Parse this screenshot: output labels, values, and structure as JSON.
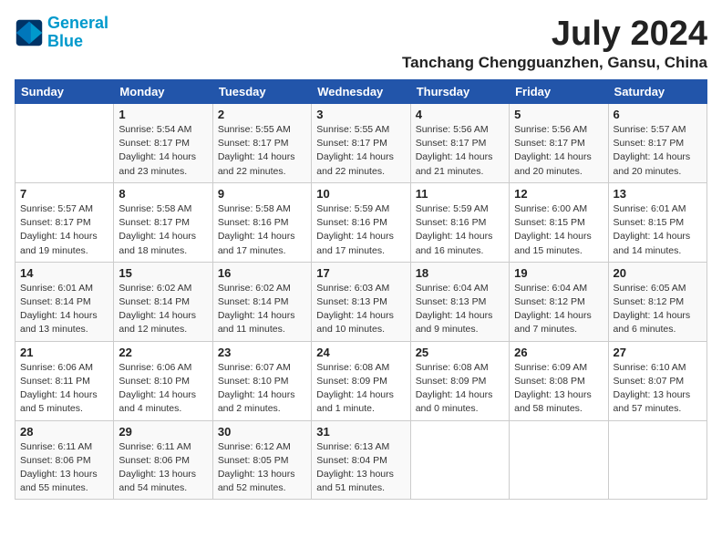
{
  "logo": {
    "line1": "General",
    "line2": "Blue"
  },
  "title": "July 2024",
  "location": "Tanchang Chengguanzhen, Gansu, China",
  "days_of_week": [
    "Sunday",
    "Monday",
    "Tuesday",
    "Wednesday",
    "Thursday",
    "Friday",
    "Saturday"
  ],
  "weeks": [
    [
      {
        "day": "",
        "detail": ""
      },
      {
        "day": "1",
        "detail": "Sunrise: 5:54 AM\nSunset: 8:17 PM\nDaylight: 14 hours\nand 23 minutes."
      },
      {
        "day": "2",
        "detail": "Sunrise: 5:55 AM\nSunset: 8:17 PM\nDaylight: 14 hours\nand 22 minutes."
      },
      {
        "day": "3",
        "detail": "Sunrise: 5:55 AM\nSunset: 8:17 PM\nDaylight: 14 hours\nand 22 minutes."
      },
      {
        "day": "4",
        "detail": "Sunrise: 5:56 AM\nSunset: 8:17 PM\nDaylight: 14 hours\nand 21 minutes."
      },
      {
        "day": "5",
        "detail": "Sunrise: 5:56 AM\nSunset: 8:17 PM\nDaylight: 14 hours\nand 20 minutes."
      },
      {
        "day": "6",
        "detail": "Sunrise: 5:57 AM\nSunset: 8:17 PM\nDaylight: 14 hours\nand 20 minutes."
      }
    ],
    [
      {
        "day": "7",
        "detail": "Sunrise: 5:57 AM\nSunset: 8:17 PM\nDaylight: 14 hours\nand 19 minutes."
      },
      {
        "day": "8",
        "detail": "Sunrise: 5:58 AM\nSunset: 8:17 PM\nDaylight: 14 hours\nand 18 minutes."
      },
      {
        "day": "9",
        "detail": "Sunrise: 5:58 AM\nSunset: 8:16 PM\nDaylight: 14 hours\nand 17 minutes."
      },
      {
        "day": "10",
        "detail": "Sunrise: 5:59 AM\nSunset: 8:16 PM\nDaylight: 14 hours\nand 17 minutes."
      },
      {
        "day": "11",
        "detail": "Sunrise: 5:59 AM\nSunset: 8:16 PM\nDaylight: 14 hours\nand 16 minutes."
      },
      {
        "day": "12",
        "detail": "Sunrise: 6:00 AM\nSunset: 8:15 PM\nDaylight: 14 hours\nand 15 minutes."
      },
      {
        "day": "13",
        "detail": "Sunrise: 6:01 AM\nSunset: 8:15 PM\nDaylight: 14 hours\nand 14 minutes."
      }
    ],
    [
      {
        "day": "14",
        "detail": "Sunrise: 6:01 AM\nSunset: 8:14 PM\nDaylight: 14 hours\nand 13 minutes."
      },
      {
        "day": "15",
        "detail": "Sunrise: 6:02 AM\nSunset: 8:14 PM\nDaylight: 14 hours\nand 12 minutes."
      },
      {
        "day": "16",
        "detail": "Sunrise: 6:02 AM\nSunset: 8:14 PM\nDaylight: 14 hours\nand 11 minutes."
      },
      {
        "day": "17",
        "detail": "Sunrise: 6:03 AM\nSunset: 8:13 PM\nDaylight: 14 hours\nand 10 minutes."
      },
      {
        "day": "18",
        "detail": "Sunrise: 6:04 AM\nSunset: 8:13 PM\nDaylight: 14 hours\nand 9 minutes."
      },
      {
        "day": "19",
        "detail": "Sunrise: 6:04 AM\nSunset: 8:12 PM\nDaylight: 14 hours\nand 7 minutes."
      },
      {
        "day": "20",
        "detail": "Sunrise: 6:05 AM\nSunset: 8:12 PM\nDaylight: 14 hours\nand 6 minutes."
      }
    ],
    [
      {
        "day": "21",
        "detail": "Sunrise: 6:06 AM\nSunset: 8:11 PM\nDaylight: 14 hours\nand 5 minutes."
      },
      {
        "day": "22",
        "detail": "Sunrise: 6:06 AM\nSunset: 8:10 PM\nDaylight: 14 hours\nand 4 minutes."
      },
      {
        "day": "23",
        "detail": "Sunrise: 6:07 AM\nSunset: 8:10 PM\nDaylight: 14 hours\nand 2 minutes."
      },
      {
        "day": "24",
        "detail": "Sunrise: 6:08 AM\nSunset: 8:09 PM\nDaylight: 14 hours\nand 1 minute."
      },
      {
        "day": "25",
        "detail": "Sunrise: 6:08 AM\nSunset: 8:09 PM\nDaylight: 14 hours\nand 0 minutes."
      },
      {
        "day": "26",
        "detail": "Sunrise: 6:09 AM\nSunset: 8:08 PM\nDaylight: 13 hours\nand 58 minutes."
      },
      {
        "day": "27",
        "detail": "Sunrise: 6:10 AM\nSunset: 8:07 PM\nDaylight: 13 hours\nand 57 minutes."
      }
    ],
    [
      {
        "day": "28",
        "detail": "Sunrise: 6:11 AM\nSunset: 8:06 PM\nDaylight: 13 hours\nand 55 minutes."
      },
      {
        "day": "29",
        "detail": "Sunrise: 6:11 AM\nSunset: 8:06 PM\nDaylight: 13 hours\nand 54 minutes."
      },
      {
        "day": "30",
        "detail": "Sunrise: 6:12 AM\nSunset: 8:05 PM\nDaylight: 13 hours\nand 52 minutes."
      },
      {
        "day": "31",
        "detail": "Sunrise: 6:13 AM\nSunset: 8:04 PM\nDaylight: 13 hours\nand 51 minutes."
      },
      {
        "day": "",
        "detail": ""
      },
      {
        "day": "",
        "detail": ""
      },
      {
        "day": "",
        "detail": ""
      }
    ]
  ]
}
